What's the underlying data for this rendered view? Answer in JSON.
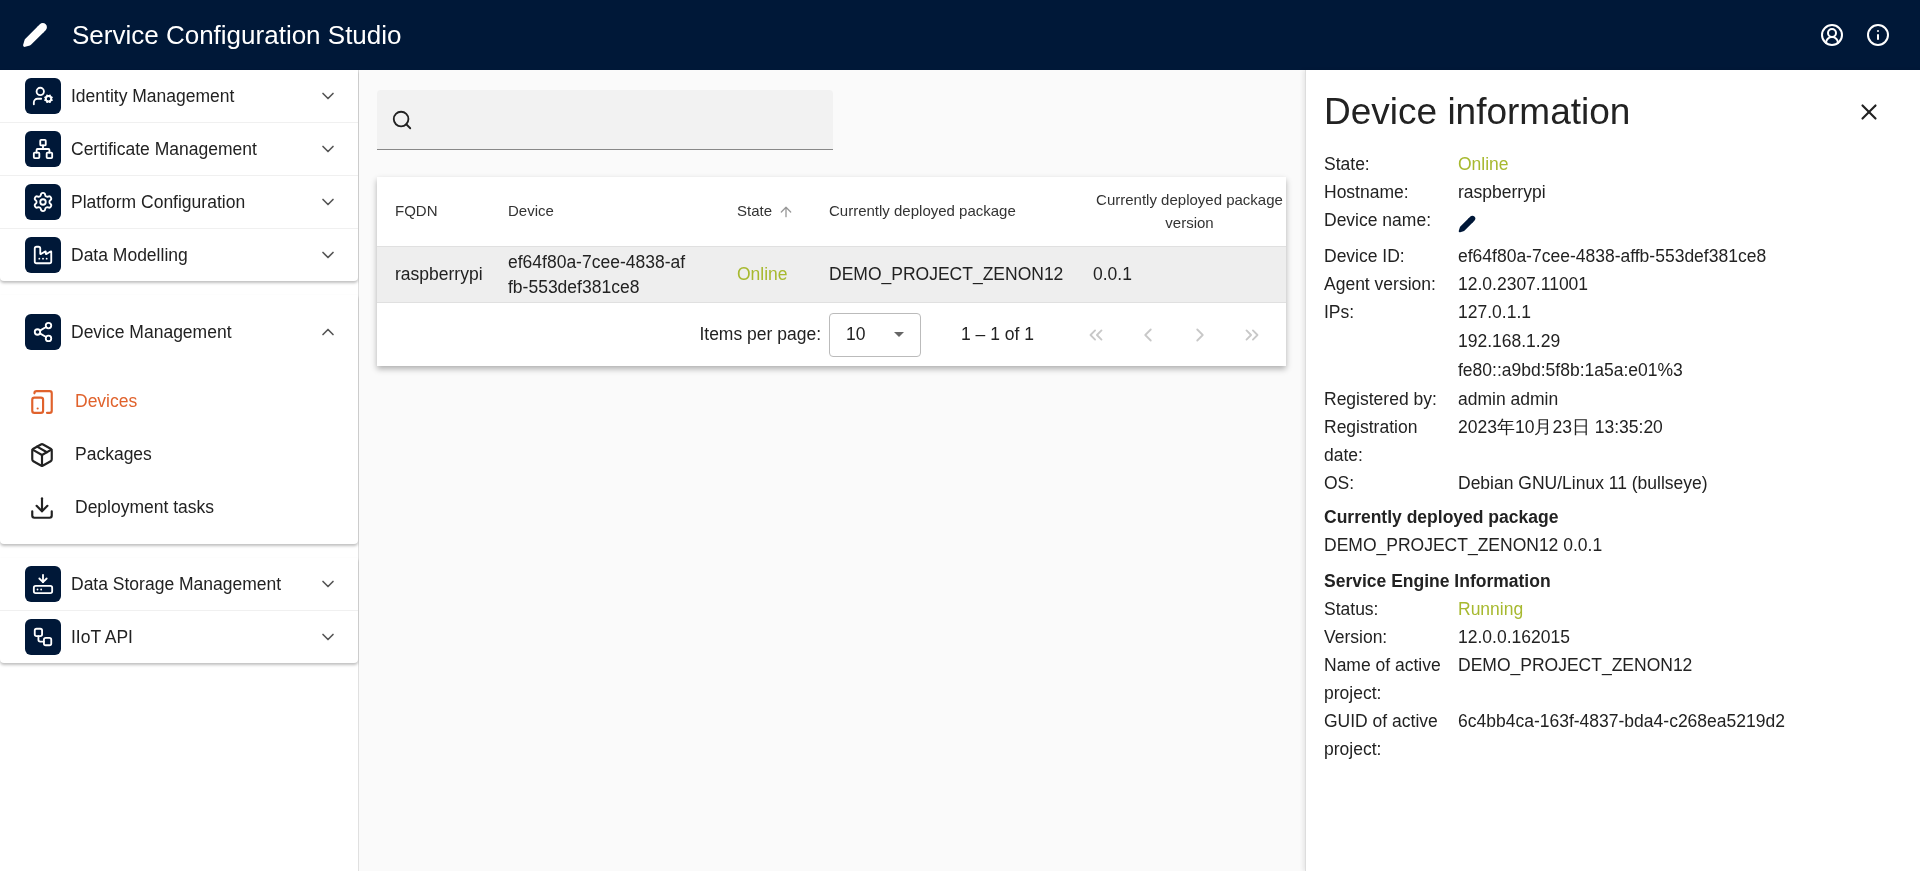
{
  "app_bar": {
    "title": "Service Configuration Studio"
  },
  "sidebar": {
    "groups": [
      {
        "items": [
          {
            "label": "Identity Management",
            "expanded": false
          },
          {
            "label": "Certificate Management",
            "expanded": false
          },
          {
            "label": "Platform Configuration",
            "expanded": false
          },
          {
            "label": "Data Modelling",
            "expanded": false
          }
        ]
      },
      {
        "items": [
          {
            "label": "Device Management",
            "expanded": true,
            "children": [
              {
                "label": "Devices",
                "selected": true
              },
              {
                "label": "Packages",
                "selected": false
              },
              {
                "label": "Deployment tasks",
                "selected": false
              }
            ]
          }
        ]
      },
      {
        "items": [
          {
            "label": "Data Storage Management",
            "expanded": false
          },
          {
            "label": "IIoT API",
            "expanded": false
          }
        ]
      }
    ]
  },
  "table": {
    "columns": [
      {
        "label": "FQDN",
        "sorted": false
      },
      {
        "label": "Device",
        "sorted": false
      },
      {
        "label": "State",
        "sorted": true
      },
      {
        "label": "Currently deployed package",
        "sorted": false
      },
      {
        "label": "Currently deployed package version",
        "sorted": false
      }
    ],
    "rows": [
      {
        "selected": true,
        "online": true,
        "cells": [
          "raspberrypi",
          "ef64f80a-7cee-4838-affb-553def381ce8",
          "Online",
          "DEMO_PROJECT_ZENON12",
          "0.0.1"
        ]
      }
    ],
    "pagination": {
      "items_per_page_label": "Items per page:",
      "items_per_page": "10",
      "range": "1 – 1 of 1",
      "first_disabled": true,
      "previous_disabled": true,
      "next_disabled": true,
      "last_disabled": true
    }
  },
  "detail_panel": {
    "title": "Device information",
    "rows": [
      {
        "kind": "status",
        "label": "State:",
        "value": "Online"
      },
      {
        "kind": "text",
        "label": "Hostname:",
        "value": "raspberrypi"
      },
      {
        "kind": "edit",
        "label": "Device name:"
      },
      {
        "kind": "text",
        "label": "Device ID:",
        "value": "ef64f80a-7cee-4838-affb-553def381ce8"
      },
      {
        "kind": "text",
        "label": "Agent version:",
        "value": "12.0.2307.11001"
      },
      {
        "kind": "list",
        "label": "IPs:",
        "values": [
          "127.0.1.1",
          "192.168.1.29",
          "fe80::a9bd:5f8b:1a5a:e01%3"
        ]
      },
      {
        "kind": "text",
        "label": "Registered by:",
        "value": "admin admin"
      },
      {
        "kind": "text",
        "label": "Registration date:",
        "value": "2023年10月23日 13:35:20"
      },
      {
        "kind": "text",
        "label": "OS:",
        "value": "Debian GNU/Linux 11 (bullseye)"
      }
    ],
    "package_section": {
      "heading": "Currently deployed package",
      "text": "DEMO_PROJECT_ZENON12 0.0.1"
    },
    "engine_section": {
      "heading": "Service Engine Information",
      "rows": [
        {
          "kind": "status",
          "label": "Status:",
          "value": "Running"
        },
        {
          "kind": "text",
          "label": "Version:",
          "value": "12.0.0.162015"
        },
        {
          "kind": "text",
          "label": "Name of active project:",
          "value": "DEMO_PROJECT_ZENON12"
        },
        {
          "kind": "text",
          "label": "GUID of active project:",
          "value": "6c4bb4ca-163f-4837-bda4-c268ea5219d2"
        }
      ]
    }
  }
}
